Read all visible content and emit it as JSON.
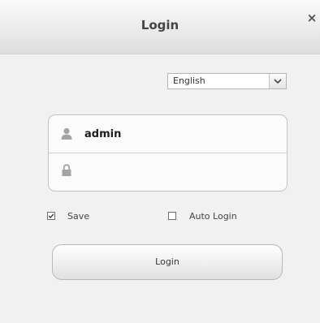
{
  "window": {
    "title": "Login",
    "close_glyph": "×"
  },
  "language": {
    "selected": "English",
    "arrow_icon": "chevron-down-icon"
  },
  "credentials": {
    "username": "admin",
    "password_value": "",
    "user_icon": "user-icon",
    "lock_icon": "lock-icon"
  },
  "options": {
    "save_label": "Save",
    "save_checked": true,
    "auto_login_label": "Auto Login",
    "auto_login_checked": false
  },
  "actions": {
    "login_label": "Login"
  },
  "colors": {
    "background": "#f1f1f1",
    "titlebar": "#e4e4e4",
    "border": "#c3c3c3",
    "text": "#333333"
  }
}
